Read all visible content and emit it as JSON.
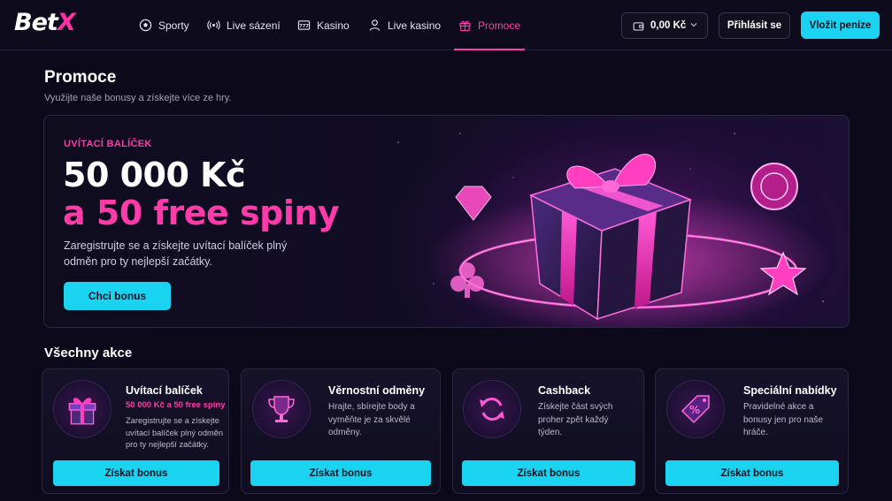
{
  "brand": {
    "name": "Bet",
    "accent": "X",
    "accent_color": "#ff2fa8"
  },
  "nav": [
    {
      "label": "Sporty",
      "icon": "soccer-ball-icon",
      "active": false
    },
    {
      "label": "Live sázení",
      "icon": "broadcast-icon",
      "active": false
    },
    {
      "label": "Kasino",
      "icon": "slot-machine-icon",
      "active": false
    },
    {
      "label": "Live kasino",
      "icon": "user-icon",
      "active": false
    },
    {
      "label": "Promoce",
      "icon": "gift-icon",
      "active": true
    }
  ],
  "header": {
    "balance": "0,00 Kč",
    "login_label": "Přihlásit se",
    "deposit_label": "Vložit peníze"
  },
  "page": {
    "title": "Promoce",
    "subtitle": "Využijte naše bonusy a získejte více ze hry."
  },
  "hero": {
    "kicker": "UVÍTACÍ BALÍČEK",
    "line1": "50 000 Kč",
    "line2": "a 50 free spiny",
    "description": "Zaregistrujte se a získejte uvítací balíček plný odměn pro ty nejlepší začátky.",
    "cta_label": "Chci bonus"
  },
  "section": {
    "title": "Všechny akce"
  },
  "cards": [
    {
      "icon": "gift-icon",
      "title": "Uvítací balíček",
      "subtitle": "50 000 Kč a 50 free spiny",
      "description": "Zaregistrujte se a získejte uvítací balíček plný odměn pro ty nejlepší začátky.",
      "button": "Získat bonus"
    },
    {
      "icon": "trophy-icon",
      "title": "Věrnostní odměny",
      "subtitle": "",
      "description": "Hrajte, sbírejte body a vyměňte je za skvělé odměny.",
      "button": "Získat bonus"
    },
    {
      "icon": "refresh-icon",
      "title": "Cashback",
      "subtitle": "",
      "description": "Získejte část svých proher zpět každý týden.",
      "button": "Získat bonus"
    },
    {
      "icon": "percent-tag-icon",
      "title": "Speciální nabídky",
      "subtitle": "",
      "description": "Pravidelné akce a bonusy jen pro naše hráče.",
      "button": "Získat bonus"
    }
  ],
  "colors": {
    "background": "#0c0a1a",
    "accent_pink": "#ff3aa9",
    "accent_cyan": "#19d3f0"
  }
}
